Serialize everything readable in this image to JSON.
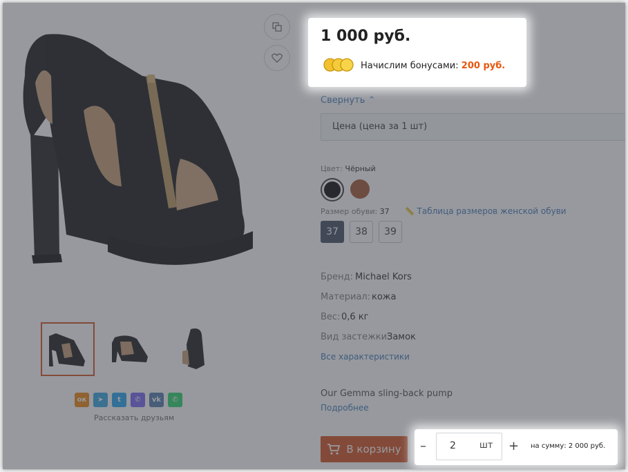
{
  "product": {
    "price": "1 000 руб.",
    "bonus_label": "Начислим бонусами:",
    "bonus_value": "200 руб.",
    "collapse_link": "Свернуть",
    "price_type": "Цена (цена за 1 шт)",
    "color_label": "Цвет:",
    "color_value": "Чёрный",
    "size_label": "Размер обуви:",
    "size_value": "37",
    "size_table_link": "Таблица размеров женской обуви",
    "sizes": [
      "37",
      "38",
      "39"
    ],
    "props": [
      {
        "label": "Бренд:",
        "value": "Michael Kors"
      },
      {
        "label": "Материал:",
        "value": "кожа"
      },
      {
        "label": "Вес:",
        "value": "0,6 кг"
      },
      {
        "label": "Вид застежки:",
        "value": "Замок"
      }
    ],
    "all_props_link": "Все характеристики",
    "description": "Our Gemma sling-back pump",
    "more_link": "Подробнее",
    "share_label": "Рассказать друзьям",
    "cart_button": "В корзину",
    "quantity": "2",
    "unit": "шт",
    "total": "на сумму: 2 000 руб.",
    "minus": "–",
    "plus": "+"
  },
  "colors": {
    "accent": "#d24c1a",
    "bonus": "#e8560c",
    "link": "#3b74b4",
    "swatch_black": "#000000",
    "swatch_brown": "#a0522d"
  },
  "social": [
    "ok-icon",
    "telegram-icon",
    "twitter-icon",
    "viber-icon",
    "vk-icon",
    "whatsapp-icon"
  ]
}
